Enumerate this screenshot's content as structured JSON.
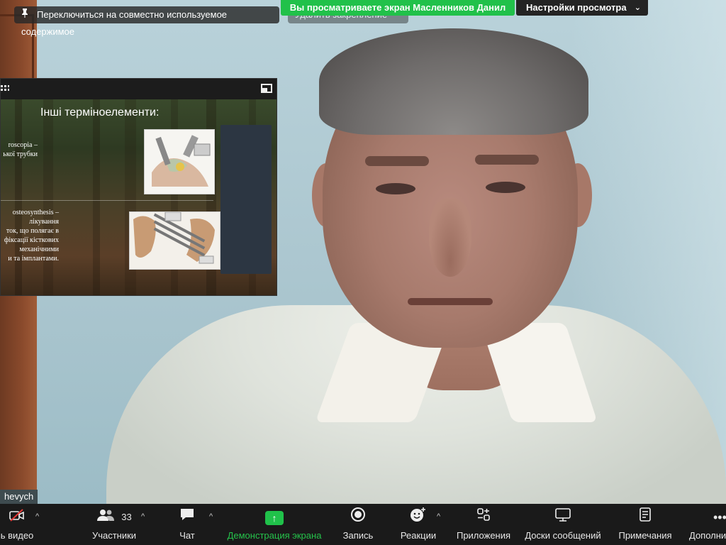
{
  "top_bar": {
    "pin_label": "Переключиться на совместно используемое содержимое",
    "unpin_label": "Удалить закрепление",
    "viewing_banner": "Вы просматриваете экран Масленников Данил",
    "view_options": "Настройки просмотра"
  },
  "slide": {
    "title": "Інші терміноелементи:",
    "text1_line1": "roscopia –",
    "text1_line2": "ької трубки",
    "text2_line1": "osteosynthesis –",
    "text2_line2": "лікування",
    "text2_line3": "ток, що полягає в",
    "text2_line4": "фіксації кісткових",
    "text2_line5": "механічними",
    "text2_line6": "и та імплантами."
  },
  "video": {
    "name_tag": "hevych"
  },
  "toolbar": {
    "video_label": "ь видео",
    "participants_label": "Участники",
    "participants_count": "33",
    "chat_label": "Чат",
    "share_label": "Демонстрация экрана",
    "record_label": "Запись",
    "reactions_label": "Реакции",
    "apps_label": "Приложения",
    "whiteboards_label": "Доски сообщений",
    "notes_label": "Примечания",
    "more_label": "Дополни"
  },
  "colors": {
    "accent_green": "#21c14a",
    "toolbar_bg": "#1a1a1a"
  }
}
